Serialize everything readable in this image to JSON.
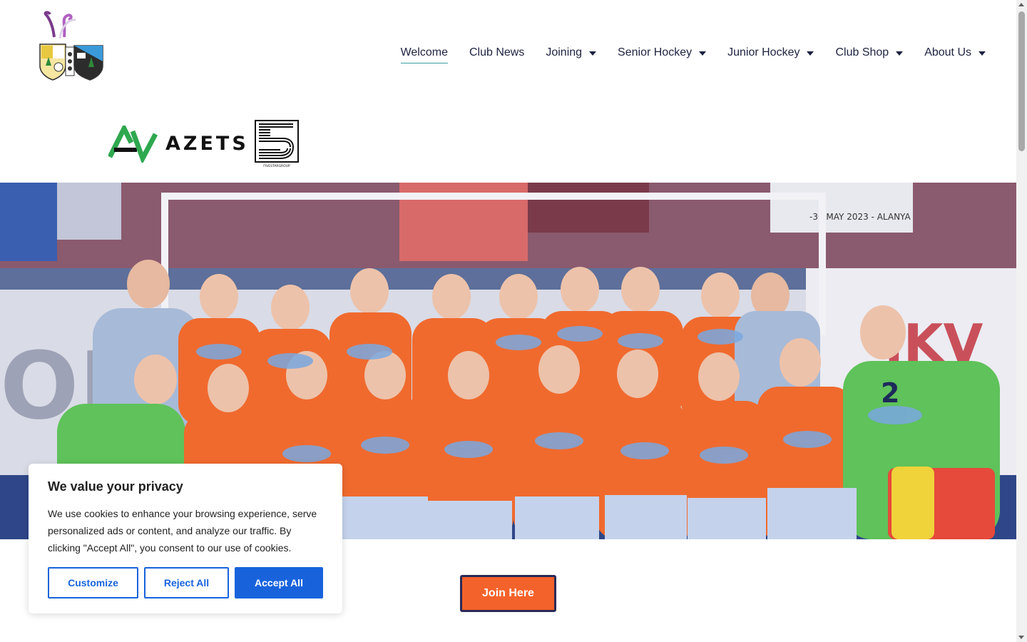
{
  "nav": {
    "items": [
      {
        "label": "Welcome",
        "active": true,
        "has_dropdown": false
      },
      {
        "label": "Club News",
        "active": false,
        "has_dropdown": false
      },
      {
        "label": "Joining",
        "active": false,
        "has_dropdown": true
      },
      {
        "label": "Senior Hockey",
        "active": false,
        "has_dropdown": true
      },
      {
        "label": "Junior Hockey",
        "active": false,
        "has_dropdown": true
      },
      {
        "label": "Club Shop",
        "active": false,
        "has_dropdown": true
      },
      {
        "label": "About Us",
        "active": false,
        "has_dropdown": true
      }
    ]
  },
  "sponsors": {
    "azets_label": "AZETS",
    "fivestar_label": "FIVESTARGROUP"
  },
  "hero": {
    "banner_text": "-30 MAY 2023 - ALANYA"
  },
  "cta": {
    "join_label": "Join Here"
  },
  "cookie": {
    "title": "We value your privacy",
    "text": "We use cookies to enhance your browsing experience, serve personalized ads or content, and analyze our traffic. By clicking \"Accept All\", you consent to our use of cookies.",
    "customize_label": "Customize",
    "reject_label": "Reject All",
    "accept_label": "Accept All"
  },
  "colors": {
    "nav_text": "#1d2240",
    "accent_underline": "#3aa0a0",
    "join_button": "#f4622b",
    "cookie_blue": "#1863dc",
    "jersey_orange": "#f06a2e"
  }
}
